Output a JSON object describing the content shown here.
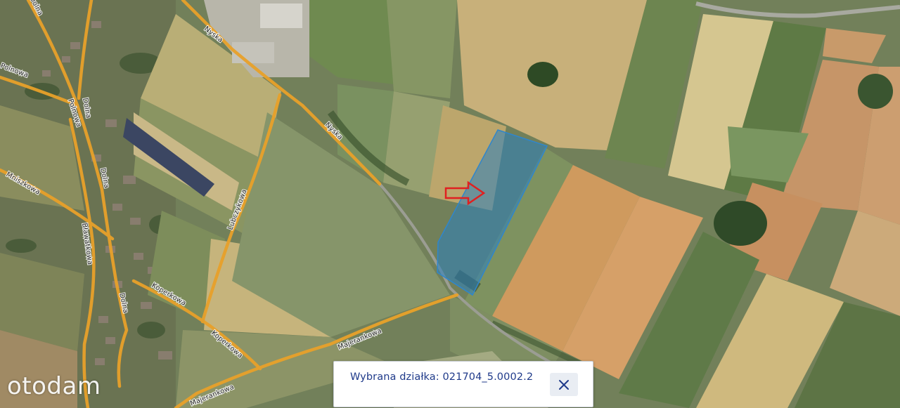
{
  "map": {
    "roads": [
      {
        "label": "Nyska"
      },
      {
        "label": "Nyska"
      },
      {
        "label": "Dolna"
      },
      {
        "label": "Dolna"
      },
      {
        "label": "Dolna"
      },
      {
        "label": "Dolna"
      },
      {
        "label": "Polnowa"
      },
      {
        "label": "Polnowa"
      },
      {
        "label": "Mniszkowa"
      },
      {
        "label": "Bławatkowa"
      },
      {
        "label": "Lubczykowa"
      },
      {
        "label": "Koperkowa"
      },
      {
        "label": "Koperkowa"
      },
      {
        "label": "Majerankowa"
      },
      {
        "label": "Majerankowa"
      }
    ],
    "parcel_highlight_color": "#2a7fc0",
    "road_color": "#e8a12a",
    "arrow_color": "#e02020"
  },
  "popup": {
    "text": "Wybrana działka: 021704_5.0002.2",
    "close_icon": "close-x-icon"
  },
  "watermark": {
    "text": "otodam"
  }
}
